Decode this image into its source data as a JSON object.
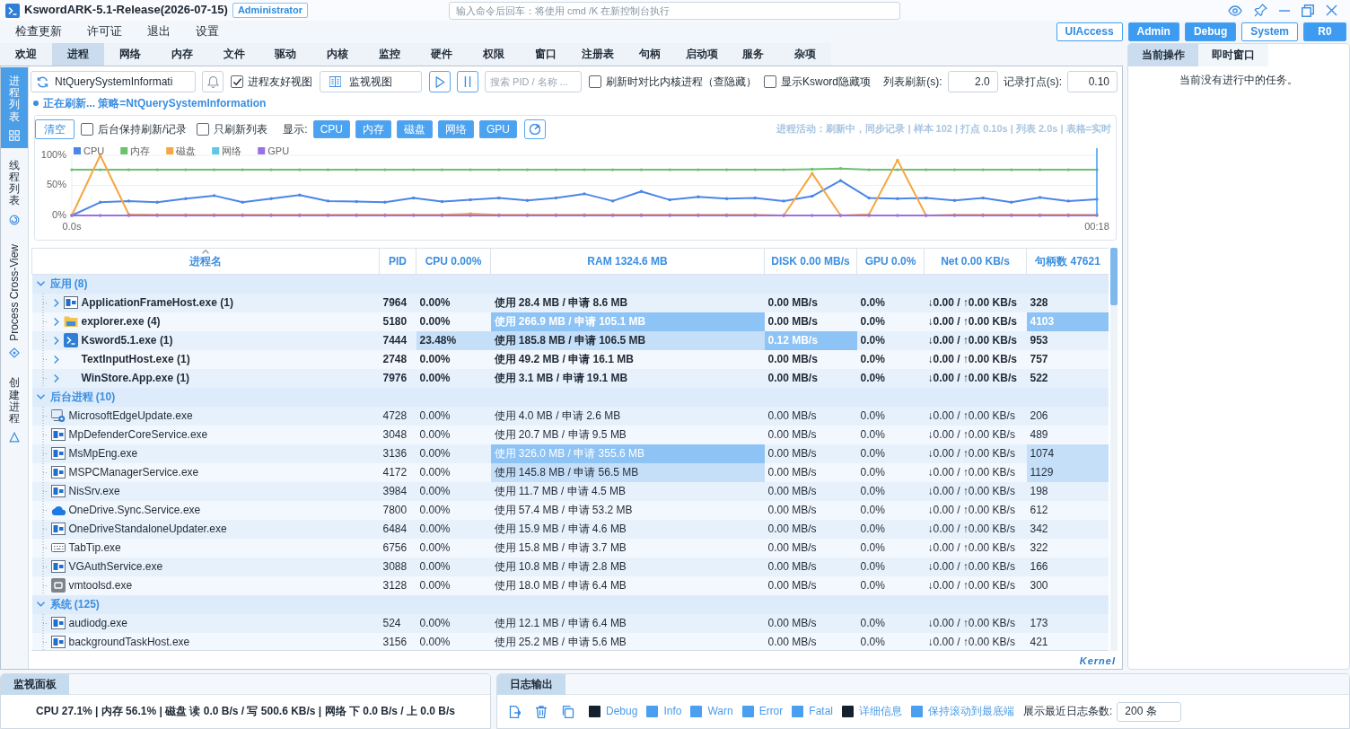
{
  "window": {
    "title": "KswordARK-5.1-Release(2026-07-15)",
    "badge": "Administrator",
    "command": {
      "placeholder": "输入命令后回车：将使用 cmd /K 在新控制台执行"
    }
  },
  "menu": [
    "检查更新",
    "许可证",
    "退出",
    "设置"
  ],
  "privileges": [
    {
      "label": "UIAccess",
      "on": false
    },
    {
      "label": "Admin",
      "on": true
    },
    {
      "label": "Debug",
      "on": true
    },
    {
      "label": "System",
      "on": false
    },
    {
      "label": "R0",
      "on": true
    }
  ],
  "tabs": [
    {
      "label": "欢迎",
      "selected": false
    },
    {
      "label": "进程",
      "selected": true
    },
    {
      "label": "网络",
      "selected": false
    },
    {
      "label": "内存",
      "selected": false
    },
    {
      "label": "文件",
      "selected": false
    },
    {
      "label": "驱动",
      "selected": false
    },
    {
      "label": "内核",
      "selected": false
    },
    {
      "label": "监控",
      "selected": false
    },
    {
      "label": "硬件",
      "selected": false
    },
    {
      "label": "权限",
      "selected": false
    },
    {
      "label": "窗口",
      "selected": false
    },
    {
      "label": "注册表",
      "selected": false
    },
    {
      "label": "句柄",
      "selected": false
    },
    {
      "label": "启动项",
      "selected": false
    },
    {
      "label": "服务",
      "selected": false
    },
    {
      "label": "杂项",
      "selected": false
    }
  ],
  "side_tabs": [
    {
      "label": "进程列表",
      "selected": true
    },
    {
      "label": "线程列表",
      "selected": false
    },
    {
      "label": "Process Cross-View",
      "selected": false
    },
    {
      "label": "创建进程",
      "selected": false
    }
  ],
  "process_toolbar": {
    "strategy": "NtQuerySystemInformati",
    "friendly_view": {
      "label": "进程友好视图",
      "checked": true
    },
    "monitor_view": "监视视图",
    "search": {
      "placeholder": "搜索 PID / 名称 ..."
    },
    "options": [
      {
        "label": "刷新时对比内核进程（查隐藏）",
        "checked": false
      },
      {
        "label": "显示Ksword隐藏项",
        "checked": false
      }
    ],
    "list_refresh": {
      "label": "列表刷新(s):",
      "value": "2.0"
    },
    "sample_interval": {
      "label": "记录打点(s):",
      "value": "0.10"
    }
  },
  "status": "正在刷新... 策略=NtQuerySystemInformation",
  "activity": {
    "clear": "清空",
    "options": [
      {
        "label": "后台保持刷新/记录",
        "checked": false
      },
      {
        "label": "只刷新列表",
        "checked": false
      }
    ],
    "show_label": "显示:",
    "series_toggles": [
      {
        "label": "CPU",
        "on": true
      },
      {
        "label": "内存",
        "on": true
      },
      {
        "label": "磁盘",
        "on": true
      },
      {
        "label": "网络",
        "on": true
      },
      {
        "label": "GPU",
        "on": true
      }
    ],
    "summary": "进程活动：刷新中，同步记录 | 样本 102 | 打点 0.10s | 列表 2.0s | 表格=实时",
    "chart_data": {
      "type": "line",
      "legend": "top-left",
      "x": [
        0,
        0.5,
        1,
        1.5,
        2,
        2.5,
        3,
        3.5,
        4,
        4.5,
        5,
        5.5,
        6,
        6.5,
        7,
        7.5,
        8,
        8.5,
        9,
        9.5,
        10,
        10.5,
        11,
        11.5,
        12,
        12.5,
        13,
        13.5,
        14,
        14.5,
        15,
        15.5,
        16,
        16.5,
        17,
        17.5,
        18
      ],
      "xlim": [
        0,
        18
      ],
      "xticks": [
        {
          "value": 0,
          "label": "0.0s"
        },
        {
          "value": 18,
          "label": "00:18"
        }
      ],
      "ylim": [
        0,
        100
      ],
      "yticks": [
        {
          "value": 0,
          "label": "0%"
        },
        {
          "value": 50,
          "label": "50%"
        },
        {
          "value": 100,
          "label": "100%"
        }
      ],
      "series": [
        {
          "name": "CPU",
          "color": "#4a86e8",
          "values": [
            0,
            22,
            24,
            22,
            28,
            33,
            22,
            28,
            34,
            24,
            23,
            22,
            29,
            23,
            26,
            29,
            25,
            29,
            36,
            24,
            40,
            26,
            31,
            28,
            29,
            24,
            32,
            58,
            29,
            28,
            29,
            25,
            29,
            22,
            30,
            24,
            27
          ]
        },
        {
          "name": "内存",
          "color": "#6cc070",
          "values": [
            76,
            76,
            76,
            76,
            76,
            76,
            76,
            76,
            76,
            76,
            76,
            76,
            76,
            76,
            76,
            76,
            76,
            76,
            76,
            76,
            76,
            76,
            76,
            76,
            76,
            76,
            77,
            78,
            76,
            76,
            76,
            76,
            76,
            76,
            76,
            76,
            76
          ]
        },
        {
          "name": "磁盘",
          "color": "#f5a742",
          "values": [
            0,
            100,
            2,
            1,
            1,
            1,
            1,
            1,
            1,
            1,
            1,
            1,
            1,
            1,
            3,
            1,
            1,
            1,
            1,
            1,
            1,
            1,
            1,
            1,
            1,
            0,
            70,
            0,
            2,
            92,
            0,
            1,
            1,
            1,
            1,
            1,
            1
          ]
        },
        {
          "name": "网络",
          "color": "#5bc8e8",
          "values": [
            null,
            null,
            null,
            null,
            null,
            null,
            null,
            null,
            null,
            null,
            null,
            null,
            null,
            null,
            null,
            null,
            null,
            null,
            null,
            null,
            null,
            null,
            null,
            null,
            null,
            null,
            null,
            null,
            null,
            null,
            null,
            null,
            null,
            null,
            null,
            null,
            null
          ]
        },
        {
          "name": "GPU",
          "color": "#9b6fe8",
          "values": [
            0,
            0,
            0,
            0,
            0,
            0,
            0,
            0,
            0,
            0,
            0,
            0,
            0,
            0,
            0,
            0,
            0,
            0,
            0,
            0,
            0,
            0,
            0,
            0,
            0,
            0,
            0,
            0,
            0,
            0,
            0,
            0,
            0,
            0,
            0,
            0,
            0
          ]
        }
      ]
    }
  },
  "table": {
    "columns": [
      {
        "label": "进程名",
        "sorted": true
      },
      {
        "label": "PID",
        "sorted": false
      },
      {
        "label": "CPU 0.00%",
        "sorted": false
      },
      {
        "label": "RAM 1324.6 MB",
        "sorted": false
      },
      {
        "label": "DISK 0.00 MB/s",
        "sorted": false
      },
      {
        "label": "GPU 0.0%",
        "sorted": false
      },
      {
        "label": "Net 0.00 KB/s",
        "sorted": false
      },
      {
        "label": "句柄数 47621",
        "sorted": false
      }
    ],
    "groups": [
      {
        "label": "应用 (8)",
        "expanded": true,
        "bold": true,
        "rows": [
          {
            "name": "ApplicationFrameHost.exe (1)",
            "kind": "window",
            "expanded": false,
            "pid": "7964",
            "cpu": "0.00%",
            "ram": "使用 28.4 MB / 申请 8.6 MB",
            "disk": "0.00 MB/s",
            "gpu": "0.0%",
            "net": "↓0.00 / ↑0.00 KB/s",
            "handles": "328"
          },
          {
            "name": "explorer.exe (4)",
            "kind": "folder",
            "expanded": false,
            "pid": "5180",
            "cpu": "0.00%",
            "ram": "使用 266.9 MB / 申请 105.1 MB",
            "disk": "0.00 MB/s",
            "gpu": "0.0%",
            "net": "↓0.00 / ↑0.00 KB/s",
            "handles": "4103",
            "highlighted": {
              "ram": true,
              "handles": true
            }
          },
          {
            "name": "Ksword5.1.exe (1)",
            "kind": "logo",
            "expanded": false,
            "pid": "7444",
            "cpu": "23.48%",
            "ram": "使用 185.8 MB / 申请 106.5 MB",
            "disk": "0.12 MB/s",
            "gpu": "0.0%",
            "net": "↓0.00 / ↑0.00 KB/s",
            "handles": "953",
            "highlighted": {
              "disk": true
            },
            "tinted": {
              "cpu": true,
              "ram": true
            }
          },
          {
            "name": "TextInputHost.exe (1)",
            "expanded": false,
            "pid": "2748",
            "cpu": "0.00%",
            "ram": "使用 49.2 MB / 申请 16.1 MB",
            "disk": "0.00 MB/s",
            "gpu": "0.0%",
            "net": "↓0.00 / ↑0.00 KB/s",
            "handles": "757"
          },
          {
            "name": "WinStore.App.exe (1)",
            "expanded": false,
            "pid": "7976",
            "cpu": "0.00%",
            "ram": "使用 3.1 MB / 申请 19.1 MB",
            "disk": "0.00 MB/s",
            "gpu": "0.0%",
            "net": "↓0.00 / ↑0.00 KB/s",
            "handles": "522"
          }
        ]
      },
      {
        "label": "后台进程 (10)",
        "expanded": true,
        "bold": false,
        "rows": [
          {
            "name": "MicrosoftEdgeUpdate.exe",
            "kind": "installer",
            "pid": "4728",
            "cpu": "0.00%",
            "ram": "使用 4.0 MB / 申请 2.6 MB",
            "disk": "0.00 MB/s",
            "gpu": "0.0%",
            "net": "↓0.00 / ↑0.00 KB/s",
            "handles": "206"
          },
          {
            "name": "MpDefenderCoreService.exe",
            "kind": "window",
            "pid": "3048",
            "cpu": "0.00%",
            "ram": "使用 20.7 MB / 申请 9.5 MB",
            "disk": "0.00 MB/s",
            "gpu": "0.0%",
            "net": "↓0.00 / ↑0.00 KB/s",
            "handles": "489"
          },
          {
            "name": "MsMpEng.exe",
            "kind": "window",
            "pid": "3136",
            "cpu": "0.00%",
            "ram": "使用 326.0 MB / 申请 355.6 MB",
            "disk": "0.00 MB/s",
            "gpu": "0.0%",
            "net": "↓0.00 / ↑0.00 KB/s",
            "handles": "1074",
            "highlighted": {
              "ram": true
            },
            "tinted": {
              "handles": true
            }
          },
          {
            "name": "MSPCManagerService.exe",
            "kind": "window",
            "pid": "4172",
            "cpu": "0.00%",
            "ram": "使用 145.8 MB / 申请 56.5 MB",
            "disk": "0.00 MB/s",
            "gpu": "0.0%",
            "net": "↓0.00 / ↑0.00 KB/s",
            "handles": "1129",
            "tinted": {
              "ram": true,
              "handles": true
            }
          },
          {
            "name": "NisSrv.exe",
            "kind": "window",
            "pid": "3984",
            "cpu": "0.00%",
            "ram": "使用 11.7 MB / 申请 4.5 MB",
            "disk": "0.00 MB/s",
            "gpu": "0.0%",
            "net": "↓0.00 / ↑0.00 KB/s",
            "handles": "198"
          },
          {
            "name": "OneDrive.Sync.Service.exe",
            "kind": "cloud",
            "pid": "7800",
            "cpu": "0.00%",
            "ram": "使用 57.4 MB / 申请 53.2 MB",
            "disk": "0.00 MB/s",
            "gpu": "0.0%",
            "net": "↓0.00 / ↑0.00 KB/s",
            "handles": "612"
          },
          {
            "name": "OneDriveStandaloneUpdater.exe",
            "kind": "window",
            "pid": "6484",
            "cpu": "0.00%",
            "ram": "使用 15.9 MB / 申请 4.6 MB",
            "disk": "0.00 MB/s",
            "gpu": "0.0%",
            "net": "↓0.00 / ↑0.00 KB/s",
            "handles": "342"
          },
          {
            "name": "TabTip.exe",
            "kind": "keyboard",
            "pid": "6756",
            "cpu": "0.00%",
            "ram": "使用 15.8 MB / 申请 3.7 MB",
            "disk": "0.00 MB/s",
            "gpu": "0.0%",
            "net": "↓0.00 / ↑0.00 KB/s",
            "handles": "322"
          },
          {
            "name": "VGAuthService.exe",
            "kind": "window",
            "pid": "3088",
            "cpu": "0.00%",
            "ram": "使用 10.8 MB / 申请 2.8 MB",
            "disk": "0.00 MB/s",
            "gpu": "0.0%",
            "net": "↓0.00 / ↑0.00 KB/s",
            "handles": "166"
          },
          {
            "name": "vmtoolsd.exe",
            "kind": "tile",
            "pid": "3128",
            "cpu": "0.00%",
            "ram": "使用 18.0 MB / 申请 6.4 MB",
            "disk": "0.00 MB/s",
            "gpu": "0.0%",
            "net": "↓0.00 / ↑0.00 KB/s",
            "handles": "300"
          }
        ]
      },
      {
        "label": "系统 (125)",
        "expanded": true,
        "bold": false,
        "rows": [
          {
            "name": "audiodg.exe",
            "kind": "window",
            "pid": "524",
            "cpu": "0.00%",
            "ram": "使用 12.1 MB / 申请 6.4 MB",
            "disk": "0.00 MB/s",
            "gpu": "0.0%",
            "net": "↓0.00 / ↑0.00 KB/s",
            "handles": "173"
          },
          {
            "name": "backgroundTaskHost.exe",
            "kind": "window",
            "pid": "3156",
            "cpu": "0.00%",
            "ram": "使用 25.2 MB / 申请 5.6 MB",
            "disk": "0.00 MB/s",
            "gpu": "0.0%",
            "net": "↓0.00 / ↑0.00 KB/s",
            "handles": "421"
          }
        ]
      }
    ]
  },
  "corner_label": "Kernel",
  "right_panel": {
    "tabs": [
      {
        "label": "当前操作",
        "selected": true
      },
      {
        "label": "即时窗口",
        "selected": false
      }
    ],
    "message": "当前没有进行中的任务。"
  },
  "monitor_panel": {
    "tab": {
      "label": "监视面板",
      "selected": true
    },
    "summary": "CPU 27.1% | 内存 56.1% | 磁盘 读 0.0 B/s / 写 500.6 KB/s | 网络 下 0.0 B/s / 上 0.0 B/s"
  },
  "log_panel": {
    "tab": {
      "label": "日志输出",
      "selected": true
    },
    "levels": [
      {
        "label": "Debug",
        "checked": false
      },
      {
        "label": "Info",
        "checked": true
      },
      {
        "label": "Warn",
        "checked": true
      },
      {
        "label": "Error",
        "checked": true
      },
      {
        "label": "Fatal",
        "checked": true
      }
    ],
    "options": [
      {
        "label": "详细信息",
        "checked": false
      },
      {
        "label": "保持滚动到最底端",
        "checked": true
      }
    ],
    "count": {
      "label": "展示最近日志条数:",
      "value": "200 条"
    }
  }
}
